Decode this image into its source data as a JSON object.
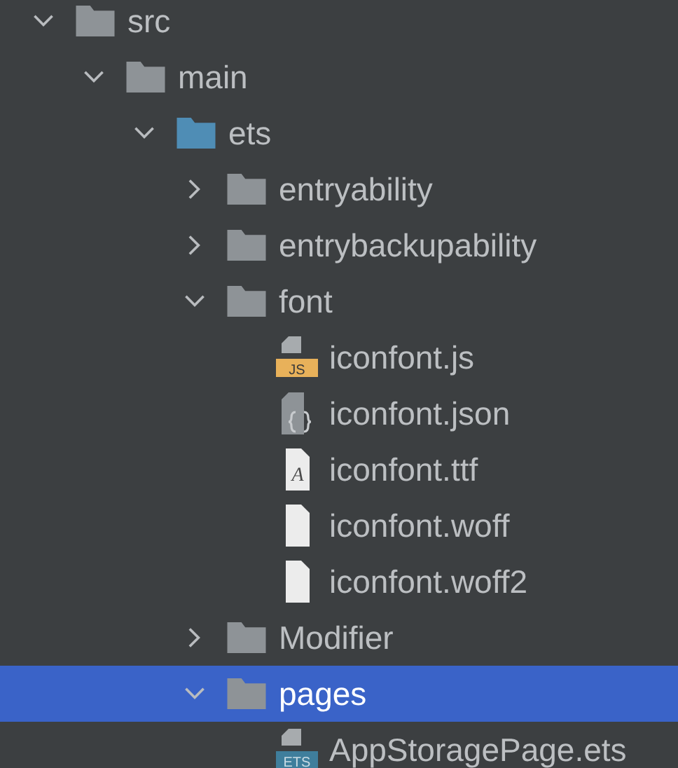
{
  "tree": [
    {
      "kind": "folder",
      "label": "src",
      "expanded": true,
      "selected": false,
      "children": [
        {
          "kind": "folder",
          "label": "main",
          "expanded": true,
          "selected": false,
          "children": [
            {
              "kind": "source-folder",
              "label": "ets",
              "expanded": true,
              "selected": false,
              "children": [
                {
                  "kind": "folder",
                  "label": "entryability",
                  "expanded": false,
                  "selected": false
                },
                {
                  "kind": "folder",
                  "label": "entrybackupability",
                  "expanded": false,
                  "selected": false
                },
                {
                  "kind": "folder",
                  "label": "font",
                  "expanded": true,
                  "selected": false,
                  "children": [
                    {
                      "kind": "js",
                      "label": "iconfont.js",
                      "badge": "JS",
                      "selected": false
                    },
                    {
                      "kind": "json",
                      "label": "iconfont.json",
                      "selected": false
                    },
                    {
                      "kind": "font",
                      "label": "iconfont.ttf",
                      "badge": "A",
                      "selected": false
                    },
                    {
                      "kind": "file",
                      "label": "iconfont.woff",
                      "selected": false
                    },
                    {
                      "kind": "file",
                      "label": "iconfont.woff2",
                      "selected": false
                    }
                  ]
                },
                {
                  "kind": "folder",
                  "label": "Modifier",
                  "expanded": false,
                  "selected": false
                },
                {
                  "kind": "folder",
                  "label": "pages",
                  "expanded": true,
                  "selected": true,
                  "children": [
                    {
                      "kind": "ets",
                      "label": "AppStoragePage.ets",
                      "badge": "ETS",
                      "selected": false
                    }
                  ]
                }
              ]
            }
          ]
        }
      ]
    }
  ]
}
